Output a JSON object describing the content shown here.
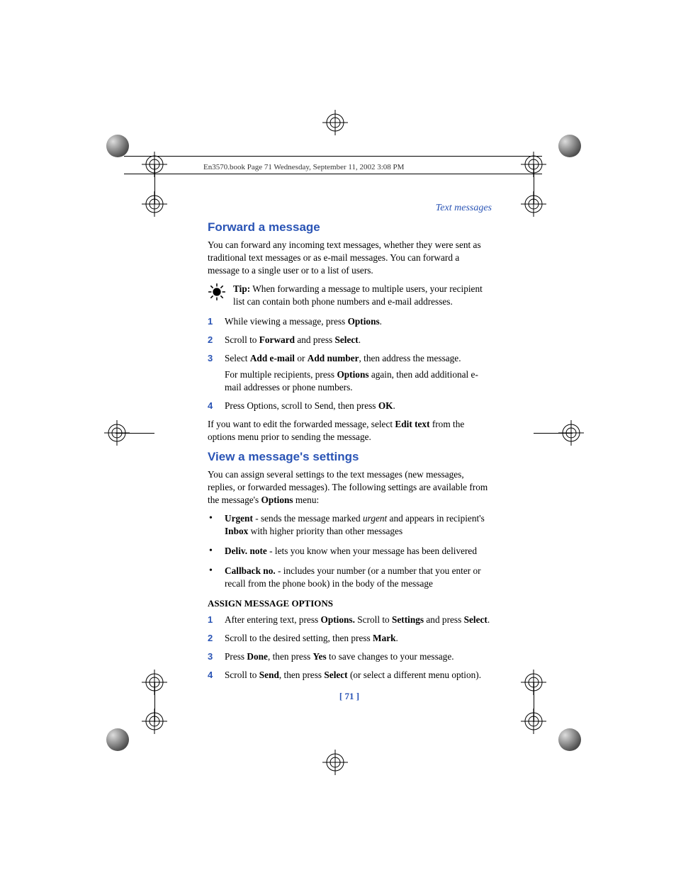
{
  "header_line": "En3570.book  Page 71  Wednesday, September 11, 2002  3:08 PM",
  "section_label": "Text messages",
  "h_forward": "Forward a message",
  "forward_intro": "You can forward any incoming text messages, whether they were sent as traditional text messages or as e-mail messages. You can forward a message to a single user or to a list of users.",
  "tip_label": "Tip:",
  "tip_text": "  When forwarding a message to multiple users, your recipient list can contain both phone numbers and e-mail addresses.",
  "fwd_steps": {
    "s1a": "While viewing a message, press ",
    "s1b": "Options",
    "s1c": ".",
    "s2a": "Scroll to ",
    "s2b": "Forward",
    "s2c": " and press ",
    "s2d": "Select",
    "s2e": ".",
    "s3a": "Select ",
    "s3b": "Add e-mail",
    "s3c": " or ",
    "s3d": "Add number",
    "s3e": ", then address the message.",
    "s3sub_a": "For multiple recipients, press ",
    "s3sub_b": "Options",
    "s3sub_c": " again, then add additional e-mail addresses or phone numbers.",
    "s4a": "Press Options, scroll to Send, then press ",
    "s4b": "OK",
    "s4c": "."
  },
  "fwd_tail_a": "If you want to edit the forwarded message, select ",
  "fwd_tail_b": "Edit text",
  "fwd_tail_c": " from the options menu prior to sending the message.",
  "h_view": "View a message's settings",
  "view_intro_a": "You can assign several settings to the text messages (new messages, replies, or forwarded messages). The following settings are available from the message's ",
  "view_intro_b": "Options",
  "view_intro_c": " menu:",
  "bullets": {
    "b1a": "Urgent",
    "b1b": " - sends the message marked ",
    "b1c": "urgent",
    "b1d": " and appears in recipient's ",
    "b1e": "Inbox",
    "b1f": " with higher priority than other messages",
    "b2a": "Deliv. note",
    "b2b": " - lets you know when your message has been delivered",
    "b3a": "Callback no.",
    "b3b": " - includes your number (or a number that you enter or recall from the phone book) in the body of the message"
  },
  "assign_head": "ASSIGN MESSAGE OPTIONS",
  "assign_steps": {
    "s1a": "After entering text, press ",
    "s1b": "Options.",
    "s1c": " Scroll to ",
    "s1d": "Settings",
    "s1e": " and press ",
    "s1f": "Select",
    "s1g": ".",
    "s2a": "Scroll to the desired setting, then press ",
    "s2b": "Mark",
    "s2c": ".",
    "s3a": "Press ",
    "s3b": "Done",
    "s3c": ", then press ",
    "s3d": "Yes",
    "s3e": " to save changes to your message.",
    "s4a": "Scroll to ",
    "s4b": "Send",
    "s4c": ", then press ",
    "s4d": "Select",
    "s4e": " (or select a different menu option)."
  },
  "page_num": "[ 71 ]",
  "nums": {
    "n1": "1",
    "n2": "2",
    "n3": "3",
    "n4": "4"
  }
}
